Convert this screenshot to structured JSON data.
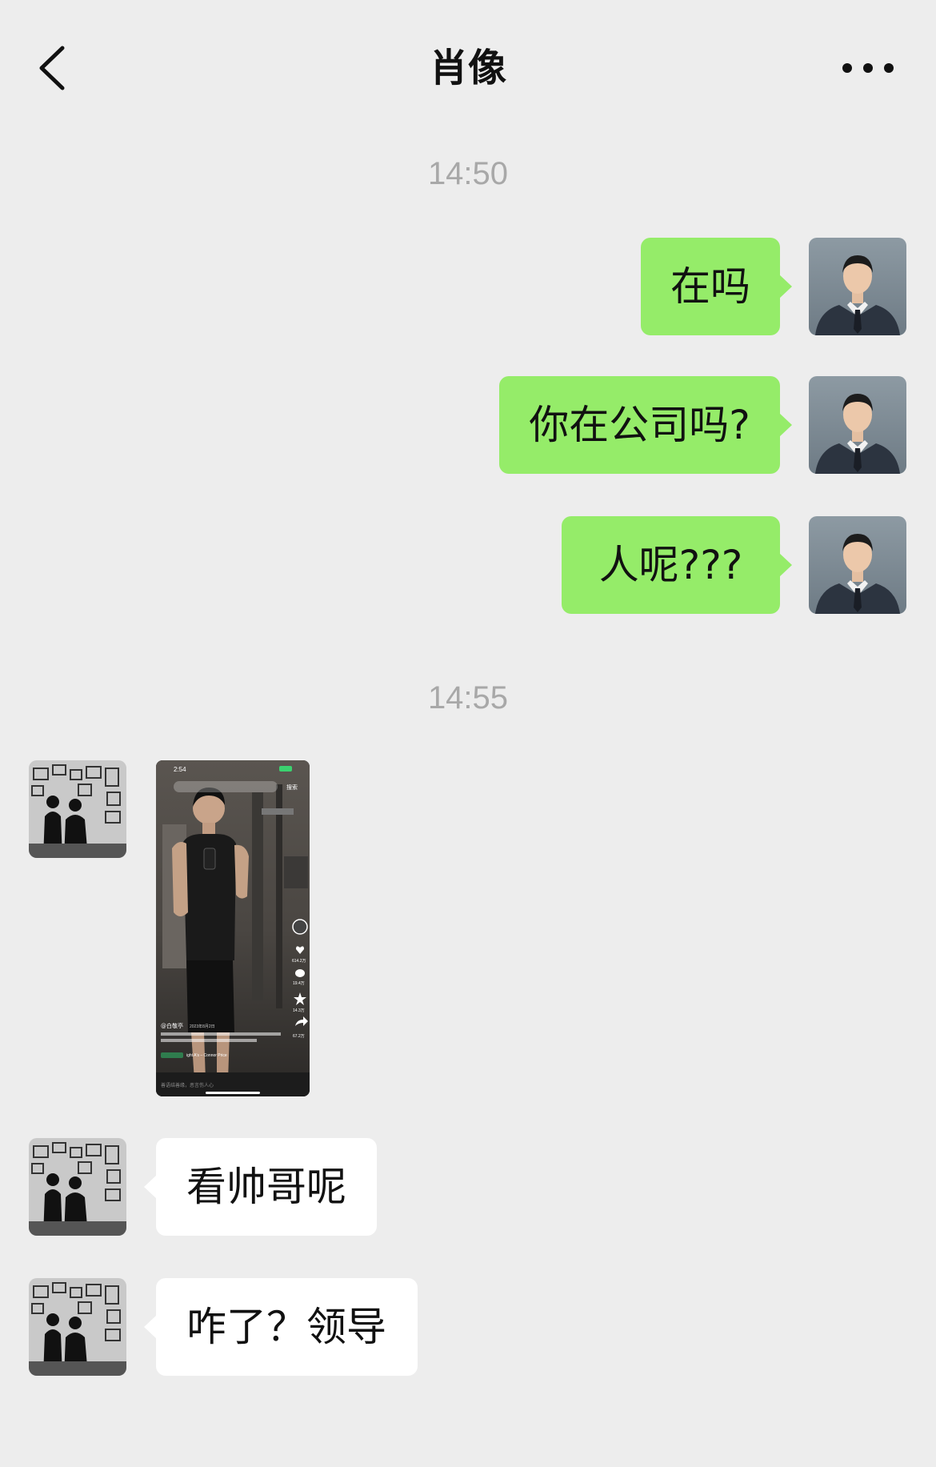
{
  "header": {
    "title": "肖像",
    "back_icon": "chevron-left-icon",
    "more_icon": "more-dots-icon"
  },
  "colors": {
    "background": "#ededed",
    "outgoing_bubble": "#95ec69",
    "incoming_bubble": "#ffffff",
    "timestamp": "#a8a8a8"
  },
  "messages": {
    "time_1": "14:50",
    "out_1": "在吗",
    "out_2": "你在公司吗?",
    "out_3": "人呢???",
    "time_2": "14:55",
    "image_1": {
      "type": "screenshot of a short-video app showing a mirror gym selfie",
      "status_time": "2:54",
      "nav_search": "搜索",
      "author": "@白敬亭",
      "date": "2023年8月2日",
      "music": "ight A's – Connor Price",
      "comment_placeholder": "善语结善缘，恶言伤人心",
      "likes": "614.2万",
      "comments": "19.4万",
      "favorites": "14.3万",
      "shares": "67.2万"
    },
    "in_1": "看帅哥呢",
    "in_2": "咋了？领导"
  }
}
